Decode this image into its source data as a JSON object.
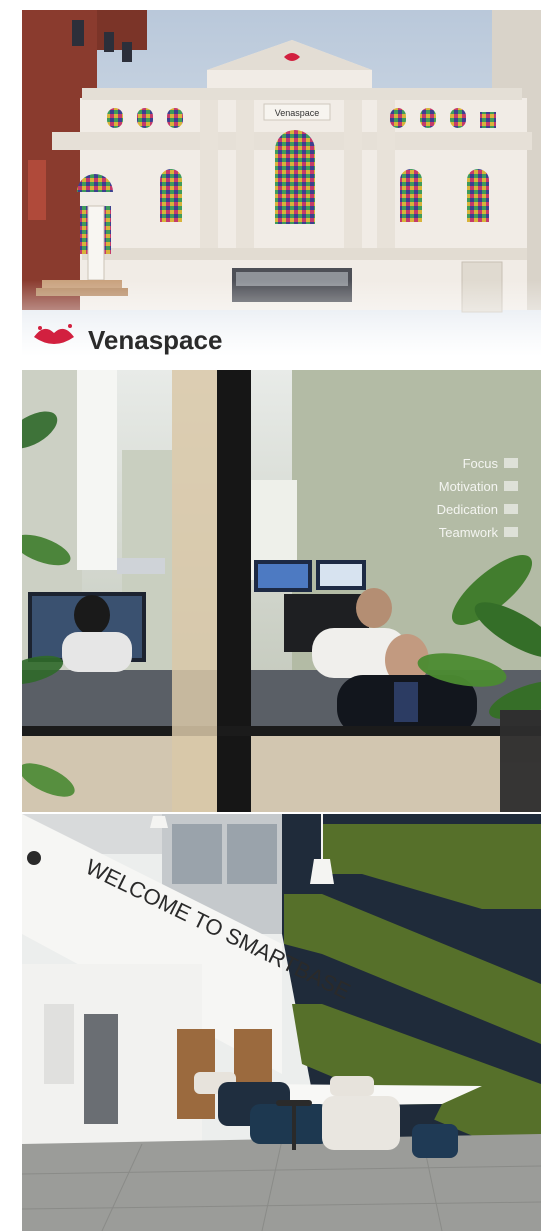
{
  "panels": [
    {
      "id": "venaspace-building",
      "building_sign": "Venaspace",
      "logo_text": "Venaspace",
      "colors": {
        "facade": "#f1ece6",
        "sky": "#c9d5e4",
        "brick": "#8a3b2e",
        "accent": "#d2203f"
      }
    },
    {
      "id": "office-interior",
      "wall_signs": [
        "Focus",
        "Motivation",
        "Dedication",
        "Teamwork"
      ],
      "colors": {
        "wall": "#b7bfae",
        "frame": "#1a1a1a",
        "plant": "#2f6a2a"
      }
    },
    {
      "id": "smartbase-lobby",
      "welcome_text": "WELCOME TO SMARTBASE",
      "colors": {
        "wall": "#f4f4f2",
        "moss": "#56702a",
        "navy": "#1f2b3a",
        "floor": "#9a9b98"
      }
    }
  ]
}
